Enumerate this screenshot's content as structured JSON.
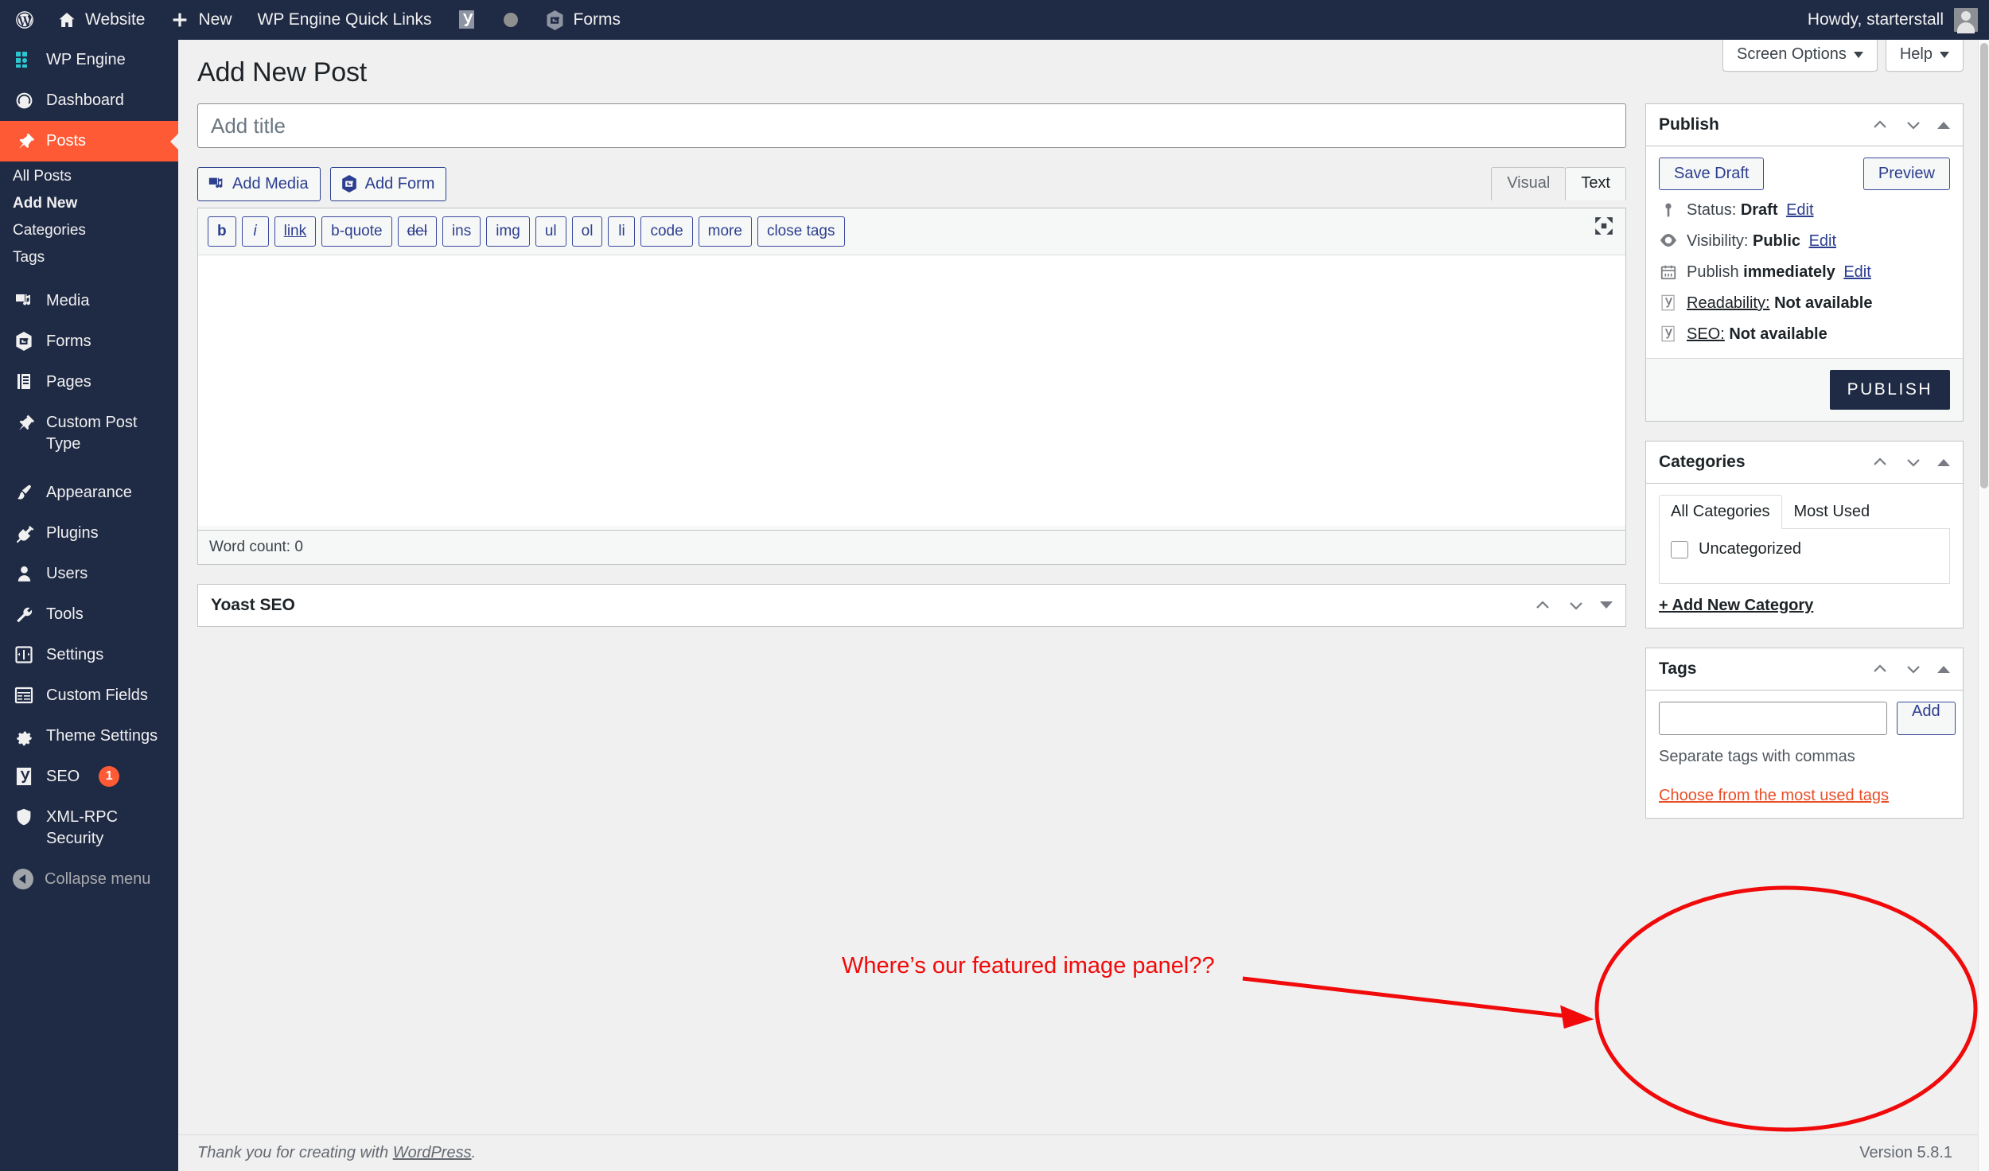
{
  "adminbar": {
    "items": [
      {
        "label": "",
        "icon": "wordpress-logo-icon"
      },
      {
        "label": "Website",
        "icon": "home-icon"
      },
      {
        "label": "New",
        "icon": "plus-icon"
      },
      {
        "label": "WP Engine Quick Links",
        "icon": ""
      },
      {
        "label": "",
        "icon": "yoast-icon"
      },
      {
        "label": "",
        "icon": "circle-icon"
      },
      {
        "label": "Forms",
        "icon": "gravity-forms-icon"
      }
    ],
    "howdy": "Howdy, starterstall",
    "avatar_name": "avatar"
  },
  "sidebar": {
    "items": [
      {
        "label": "WP Engine",
        "icon": "wp-engine-icon",
        "current": false
      },
      {
        "label": "Dashboard",
        "icon": "dashboard-icon",
        "current": false
      },
      {
        "label": "Posts",
        "icon": "pin-icon",
        "current": true
      },
      {
        "label": "Media",
        "icon": "media-icon",
        "current": false
      },
      {
        "label": "Forms",
        "icon": "gravity-forms-icon",
        "current": false
      },
      {
        "label": "Pages",
        "icon": "pages-icon",
        "current": false
      },
      {
        "label": "Custom Post Type",
        "icon": "pin-icon",
        "current": false
      },
      {
        "label": "Appearance",
        "icon": "paintbrush-icon",
        "current": false
      },
      {
        "label": "Plugins",
        "icon": "plug-icon",
        "current": false
      },
      {
        "label": "Users",
        "icon": "user-icon",
        "current": false
      },
      {
        "label": "Tools",
        "icon": "wrench-icon",
        "current": false
      },
      {
        "label": "Settings",
        "icon": "settings-icon",
        "current": false
      },
      {
        "label": "Custom Fields",
        "icon": "custom-fields-icon",
        "current": false
      },
      {
        "label": "Theme Settings",
        "icon": "gear-icon",
        "current": false
      },
      {
        "label": "SEO",
        "icon": "yoast-icon",
        "current": false,
        "badge": "1"
      },
      {
        "label": "XML-RPC Security",
        "icon": "shield-icon",
        "current": false
      }
    ],
    "submenu": [
      {
        "label": "All Posts",
        "current": false
      },
      {
        "label": "Add New",
        "current": true
      },
      {
        "label": "Categories",
        "current": false
      },
      {
        "label": "Tags",
        "current": false
      }
    ],
    "collapse_label": "Collapse menu"
  },
  "screen_meta": {
    "screen_options": "Screen Options",
    "help": "Help"
  },
  "page": {
    "title": "Add New Post"
  },
  "title_field": {
    "placeholder": "Add title",
    "value": ""
  },
  "editor": {
    "add_media": "Add Media",
    "add_form": "Add Form",
    "tabs": [
      {
        "label": "Visual",
        "active": false
      },
      {
        "label": "Text",
        "active": true
      }
    ],
    "quicktags": [
      "b",
      "i",
      "link",
      "b-quote",
      "del",
      "ins",
      "img",
      "ul",
      "ol",
      "li",
      "code",
      "more",
      "close tags"
    ],
    "content": "",
    "word_count": "Word count: 0",
    "dfw_icon": "fullscreen-icon"
  },
  "yoast_metabox": {
    "title": "Yoast SEO"
  },
  "publish": {
    "title": "Publish",
    "save_draft": "Save Draft",
    "preview": "Preview",
    "rows": [
      {
        "icon": "pin-icon",
        "label": "Status:",
        "value": "Draft",
        "edit": "Edit",
        "underline_label": false
      },
      {
        "icon": "visibility-icon",
        "label": "Visibility:",
        "value": "Public",
        "edit": "Edit",
        "underline_label": false
      },
      {
        "icon": "calendar-icon",
        "label": "Publish",
        "value": "immediately",
        "edit": "Edit",
        "underline_label": false
      },
      {
        "icon": "yoast-icon",
        "label": "Readability:",
        "value": "Not available",
        "edit": "",
        "underline_label": true
      },
      {
        "icon": "yoast-icon",
        "label": "SEO:",
        "value": "Not available",
        "edit": "",
        "underline_label": true
      }
    ],
    "publish_button": "PUBLISH"
  },
  "categories": {
    "title": "Categories",
    "tabs": [
      {
        "label": "All Categories",
        "active": true
      },
      {
        "label": "Most Used",
        "active": false
      }
    ],
    "items": [
      {
        "label": "Uncategorized",
        "checked": false
      }
    ],
    "add_new": "+ Add New Category"
  },
  "tags": {
    "title": "Tags",
    "input_value": "",
    "add_label": "Add",
    "hint": "Separate tags with commas",
    "most_used": "Choose from the most used tags"
  },
  "annotation": {
    "text": "Where’s our featured image panel??",
    "color": "#f00a0a"
  },
  "footer": {
    "left_prefix": "Thank you for creating with ",
    "left_link": "WordPress",
    "left_suffix": ".",
    "version": "Version 5.8.1"
  },
  "colors": {
    "admin_bg": "#1f2a44",
    "accent_current": "#ff5a36",
    "link_blue": "#2c3e8f",
    "annotation_red": "#f00a0a",
    "page_bg": "#f0f0f1"
  }
}
